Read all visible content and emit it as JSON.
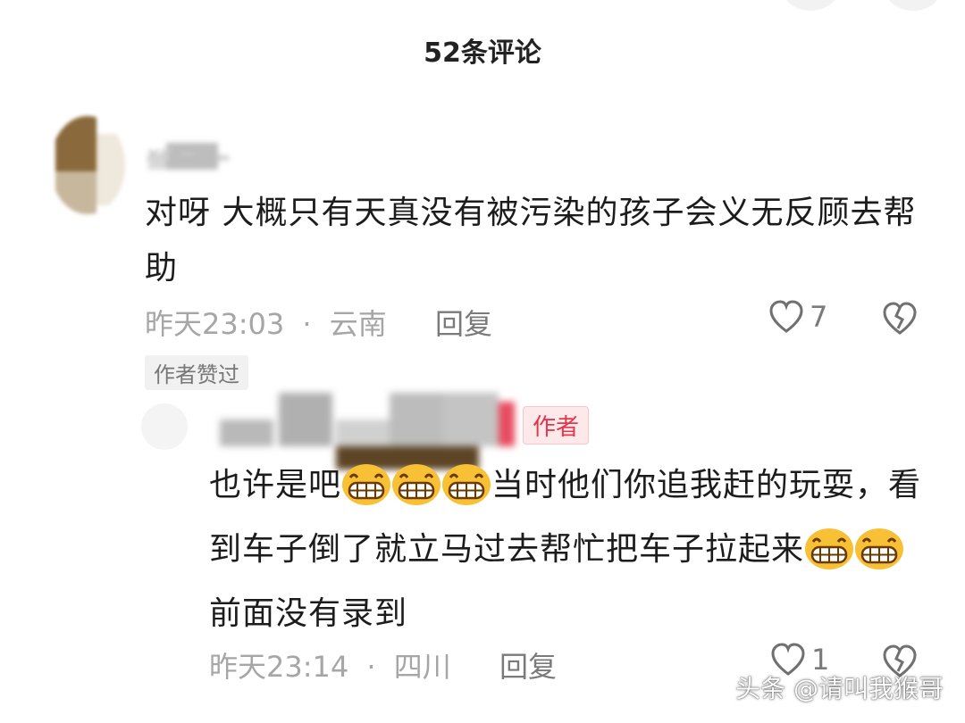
{
  "header": {
    "title": "52条评论"
  },
  "comments": [
    {
      "username": "𝘹𝘹 ~",
      "text": "对呀 大概只有天真没有被污染的孩子会义无反顾去帮助",
      "time": "昨天23:03",
      "separator": "·",
      "location": "云南",
      "reply_label": "回复",
      "likes": "7",
      "badge": "作者赞过"
    },
    {
      "author_tag": "作者",
      "text_parts": [
        "也许是吧",
        "当时他们你追我赶的玩耍，看到车子倒了就立马过去帮忙把车子拉起来",
        "前面没有录到"
      ],
      "emoji_name": "grinning-face-emoji",
      "time": "昨天23:14",
      "separator": "·",
      "location": "四川",
      "reply_label": "回复",
      "likes": "1"
    }
  ],
  "watermark": "头条 @请叫我猴哥",
  "colors": {
    "author_tag_bg": "#fde8ea",
    "author_tag_text": "#e5364d",
    "meta_text": "#a6a6a6"
  }
}
